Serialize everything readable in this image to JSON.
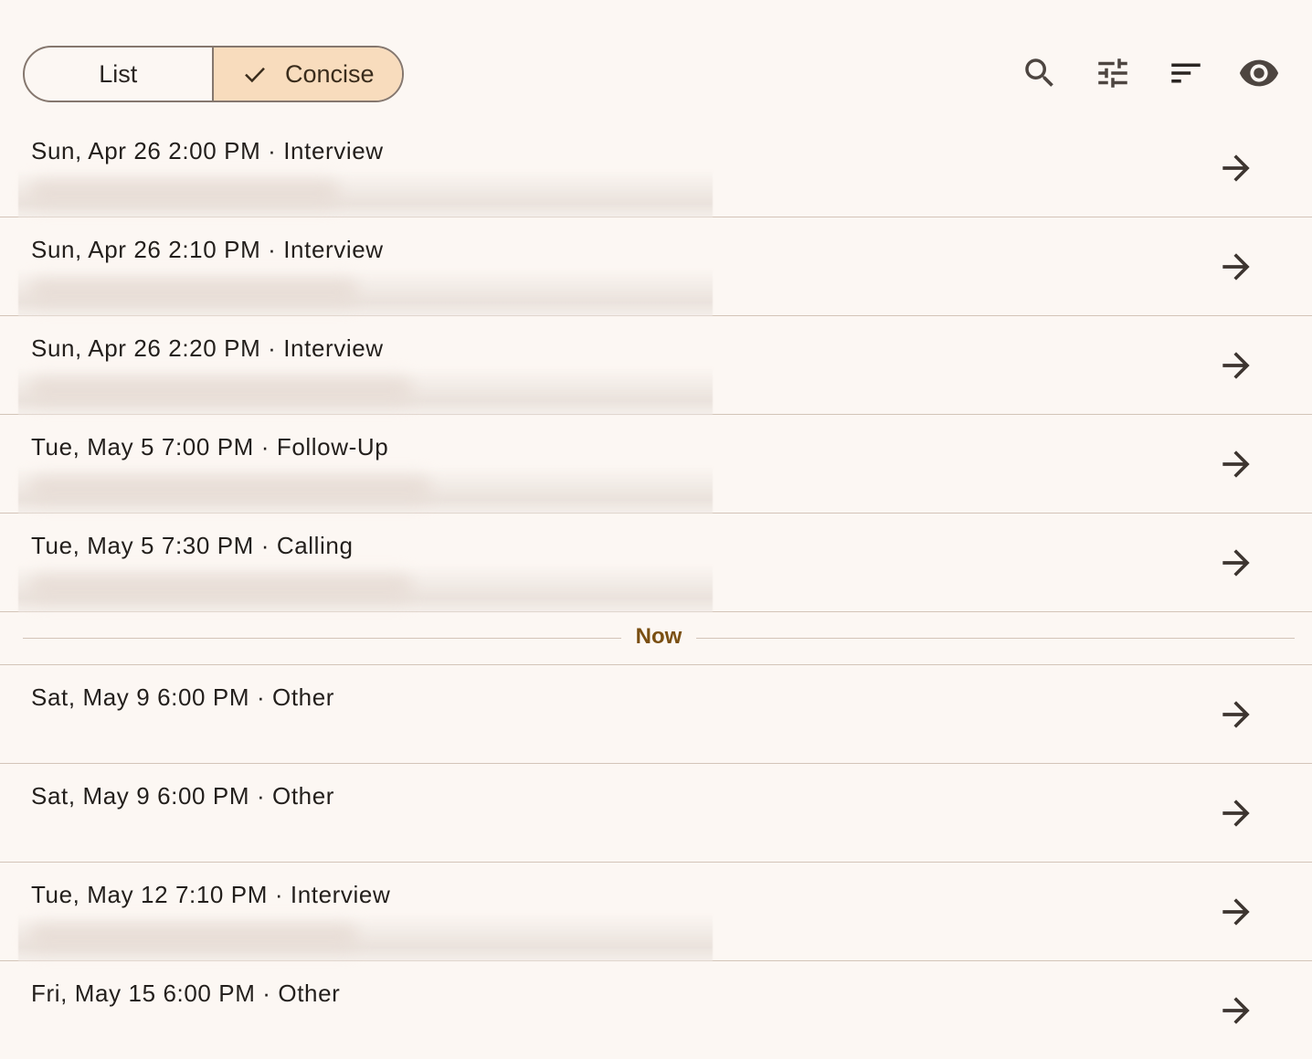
{
  "view_toggle": {
    "list_label": "List",
    "concise_label": "Concise",
    "selected": "Concise"
  },
  "toolbar_icons": [
    "search-icon",
    "tune-icon",
    "sort-icon",
    "visibility-icon"
  ],
  "rows_before_now": [
    {
      "title": "Sun, Apr 26 2:00 PM · Interview",
      "has_redacted_subtitle": true
    },
    {
      "title": "Sun, Apr 26 2:10 PM · Interview",
      "has_redacted_subtitle": true
    },
    {
      "title": "Sun, Apr 26 2:20 PM · Interview",
      "has_redacted_subtitle": true
    },
    {
      "title": "Tue, May 5 7:00 PM · Follow-Up",
      "has_redacted_subtitle": true
    },
    {
      "title": "Tue, May 5 7:30 PM · Calling",
      "has_redacted_subtitle": true
    }
  ],
  "now_label": "Now",
  "rows_after_now": [
    {
      "title": "Sat, May 9 6:00 PM · Other",
      "has_redacted_subtitle": false
    },
    {
      "title": "Sat, May 9 6:00 PM · Other",
      "has_redacted_subtitle": false
    },
    {
      "title": "Tue, May 12 7:10 PM · Interview",
      "has_redacted_subtitle": true
    },
    {
      "title": "Fri, May 15 6:00 PM · Other",
      "has_redacted_subtitle": false
    }
  ],
  "colors": {
    "background": "#fcf7f3",
    "selected_segment": "#f8dcbd",
    "divider": "#d3c4b8",
    "now_label": "#7a4f12",
    "icon": "#4d4540"
  }
}
